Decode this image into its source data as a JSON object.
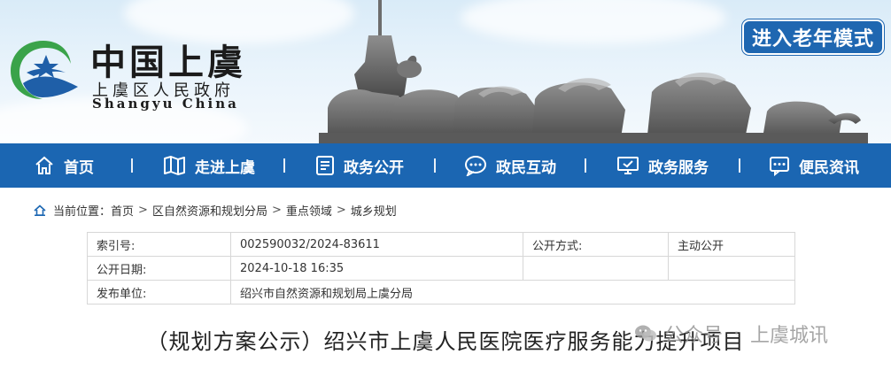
{
  "banner": {
    "logo_title": "中国上虞",
    "logo_subtitle": "上虞区人民政府",
    "logo_en": "Shangyu China",
    "elder_mode_label": "进入老年模式"
  },
  "nav": {
    "items": [
      {
        "label": "首页",
        "icon": "home-icon"
      },
      {
        "label": "走进上虞",
        "icon": "map-icon"
      },
      {
        "label": "政务公开",
        "icon": "document-icon"
      },
      {
        "label": "政民互动",
        "icon": "chat-icon"
      },
      {
        "label": "政务服务",
        "icon": "monitor-icon"
      },
      {
        "label": "便民资讯",
        "icon": "message-icon"
      }
    ]
  },
  "breadcrumb": {
    "prefix": "当前位置：",
    "items": [
      "首页",
      "区自然资源和规划分局",
      "重点领域",
      "城乡规划"
    ],
    "separator": ">"
  },
  "info": {
    "index_label": "索引号:",
    "index_value": "002590032/2024-83611",
    "method_label": "公开方式:",
    "method_value": "主动公开",
    "date_label": "公开日期:",
    "date_value": "2024-10-18 16:35",
    "publisher_label": "发布单位:",
    "publisher_value": "绍兴市自然资源和规划局上虞分局"
  },
  "article": {
    "title": "（规划方案公示）绍兴市上虞人民医院医疗服务能力提升项目"
  },
  "watermark": {
    "source": "公众号",
    "account": "上虞城讯"
  },
  "colors": {
    "nav_bg": "#1b66b2",
    "elder_btn_bg": "#1f67b1",
    "logo_green": "#3aa34a",
    "logo_blue": "#1f5fa8"
  }
}
